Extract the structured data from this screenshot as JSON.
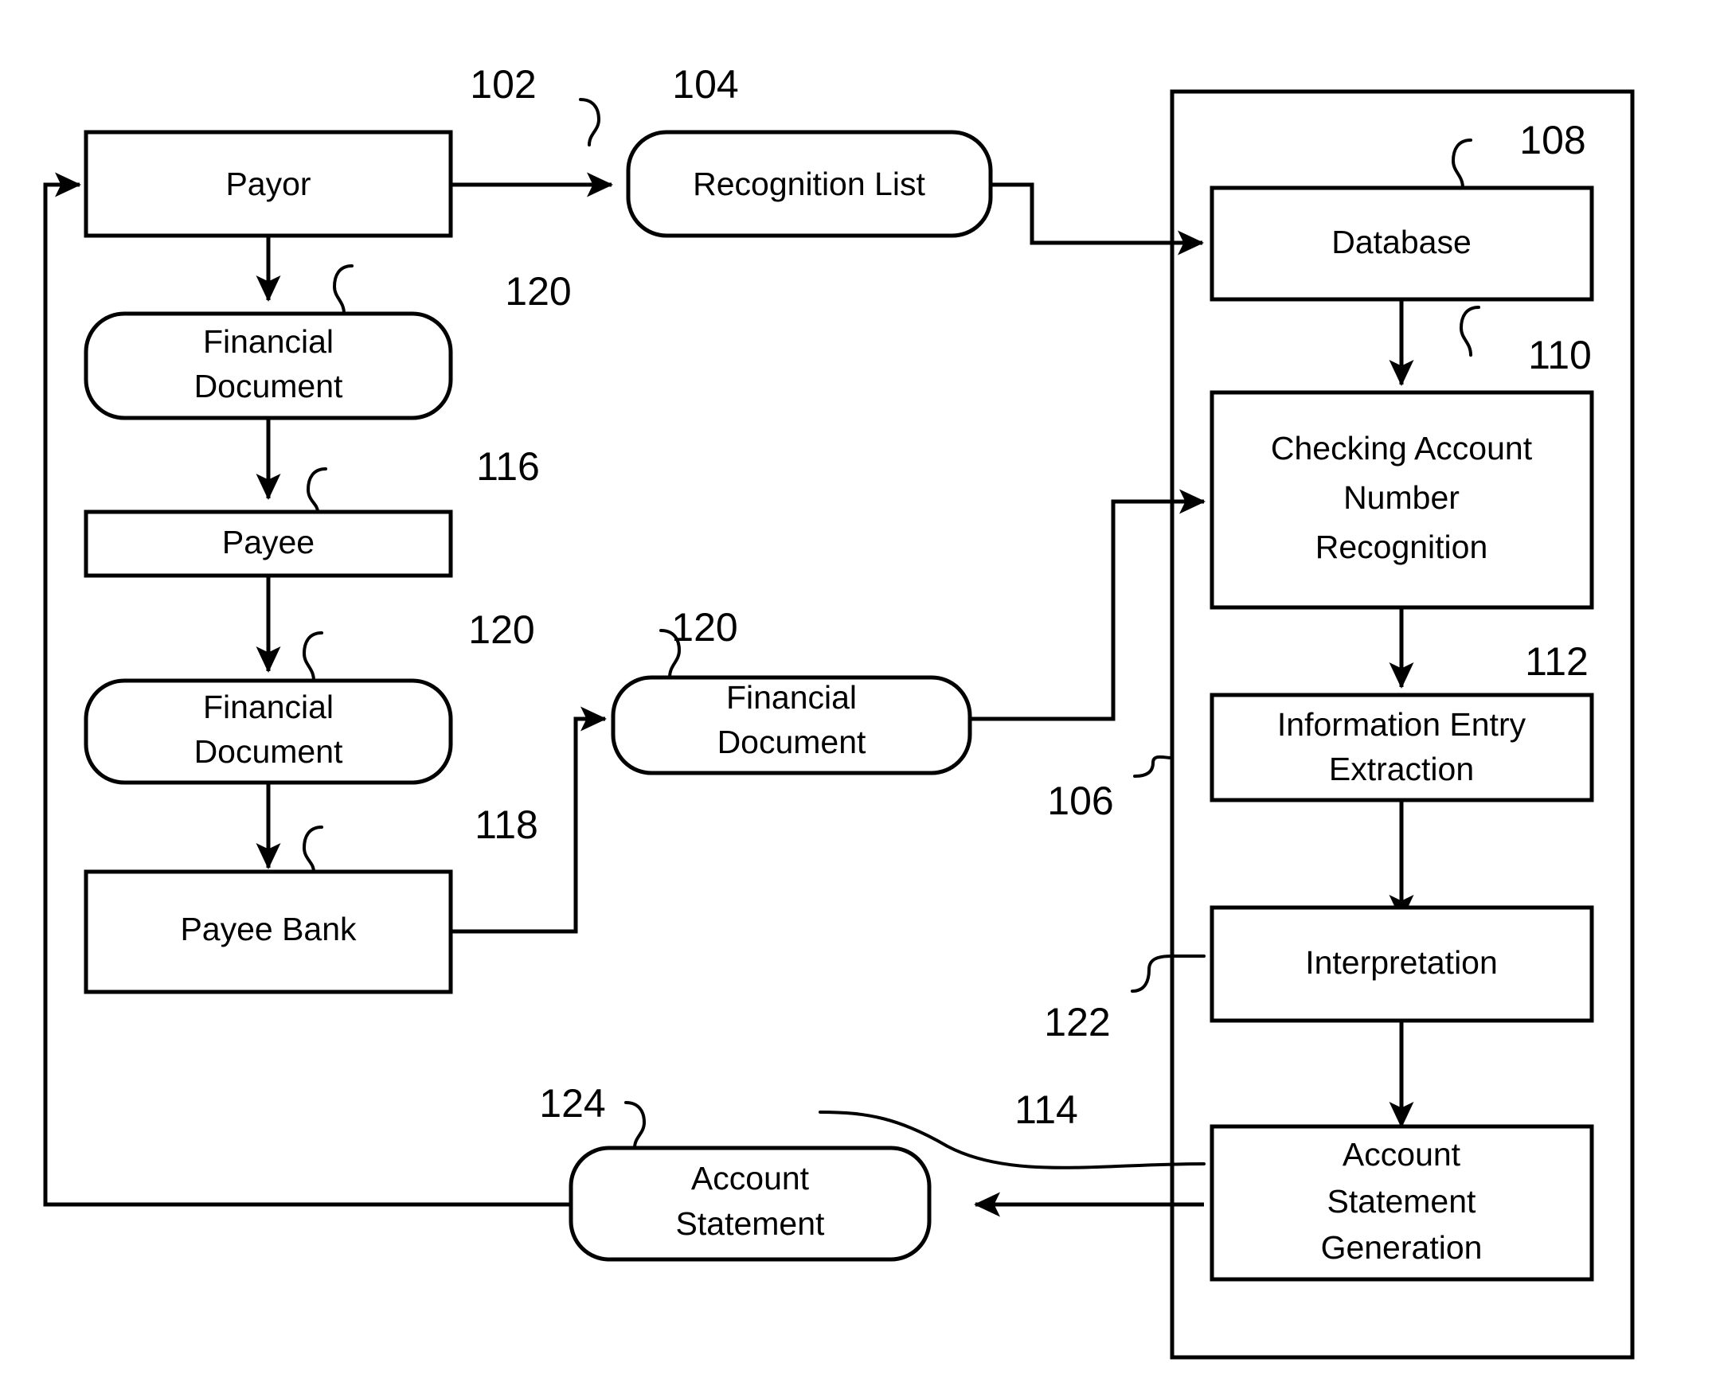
{
  "figure": {
    "type": "patent-flow-diagram",
    "background": "#ffffff",
    "line_color": "#000000"
  },
  "nodes": {
    "payor": {
      "label": "Payor",
      "ref": "102",
      "shape": "rect"
    },
    "recognition_list": {
      "label": "Recognition List",
      "ref": "104",
      "shape": "rounded"
    },
    "database": {
      "label": "Database",
      "ref": "108",
      "shape": "rect"
    },
    "fin_doc_1": {
      "line1": "Financial",
      "line2": "Document",
      "ref": "120",
      "shape": "rounded"
    },
    "payee": {
      "label": "Payee",
      "ref": "116",
      "shape": "rect"
    },
    "fin_doc_2": {
      "line1": "Financial",
      "line2": "Document",
      "ref": "120",
      "shape": "rounded"
    },
    "fin_doc_3": {
      "line1": "Financial",
      "line2": "Document",
      "ref": "120",
      "shape": "rounded"
    },
    "payee_bank": {
      "label": "Payee Bank",
      "ref": "118",
      "shape": "rect"
    },
    "checking_account": {
      "line1": "Checking Account",
      "line2": "Number",
      "line3": "Recognition",
      "ref": "110",
      "shape": "rect"
    },
    "info_entry": {
      "line1": "Information Entry",
      "line2": "Extraction",
      "ref": "112",
      "shape": "rect"
    },
    "interpretation": {
      "label": "Interpretation",
      "ref": "122",
      "shape": "rect"
    },
    "acct_stmt_gen": {
      "line1": "Account",
      "line2": "Statement",
      "line3": "Generation",
      "ref": "114",
      "shape": "rect"
    },
    "account_statement": {
      "line1": "Account",
      "line2": "Statement",
      "ref": "124",
      "shape": "rounded"
    },
    "system_container": {
      "ref": "106",
      "shape": "rect-outline"
    }
  },
  "reference_numerals": {
    "n102": "102",
    "n104": "104",
    "n106": "106",
    "n108": "108",
    "n110": "110",
    "n112": "112",
    "n114": "114",
    "n116": "116",
    "n118": "118",
    "n120a": "120",
    "n120b": "120",
    "n120c": "120",
    "n122": "122",
    "n124": "124"
  }
}
